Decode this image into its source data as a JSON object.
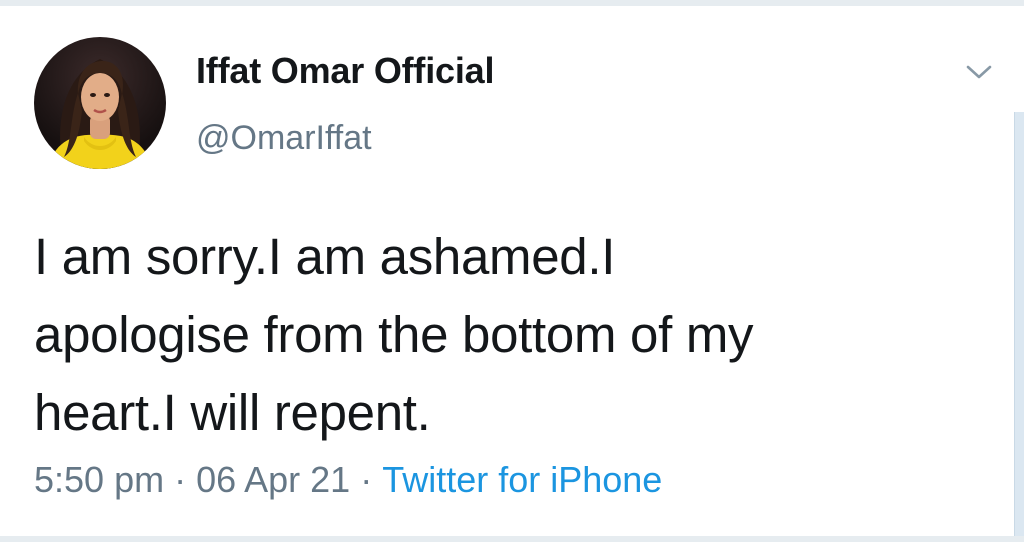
{
  "tweet": {
    "author": {
      "display_name": "Iffat Omar Official",
      "handle": "@OmarIffat",
      "avatar_icon": "profile-photo"
    },
    "text_lines": [
      "I am sorry.I am ashamed.I",
      "apologise from the bottom of my",
      "heart.I will repent."
    ],
    "time": "5:50 pm",
    "date": "06 Apr 21",
    "separator": "·",
    "source": "Twitter for iPhone",
    "menu_icon": "chevron-down-icon"
  },
  "colors": {
    "text_primary": "#14171a",
    "text_secondary": "#657786",
    "link": "#1b95e0",
    "divider": "#e6ecf0"
  }
}
